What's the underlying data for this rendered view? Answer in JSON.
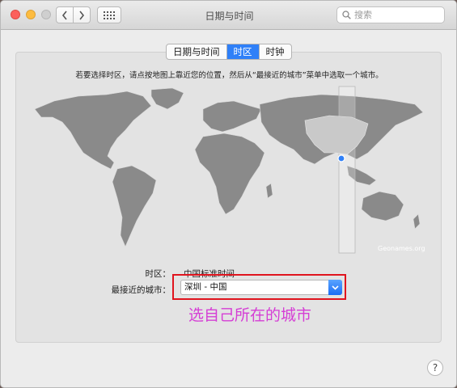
{
  "window": {
    "title": "日期与时间",
    "search_placeholder": "搜索"
  },
  "tabs": [
    {
      "label": "日期与时间",
      "active": false
    },
    {
      "label": "时区",
      "active": true
    },
    {
      "label": "时钟",
      "active": false
    }
  ],
  "instruction": "若要选择时区，请点按地图上靠近您的位置，然后从“最接近的城市”菜单中选取一个城市。",
  "map": {
    "credit": "Geonames.org",
    "marker_color": "#2f80f8"
  },
  "timezone": {
    "label": "时区：",
    "value": "中国标准时间"
  },
  "closest_city": {
    "label": "最接近的城市：",
    "value": "深圳 - 中国"
  },
  "annotation": {
    "text": "选自己所在的城市",
    "color": "#d53ed5",
    "box_color": "#e0141e"
  },
  "help": "?",
  "colors": {
    "accent": "#2f80f8",
    "land": "#8a8a8a",
    "highlight_land": "#c9c9c9"
  }
}
